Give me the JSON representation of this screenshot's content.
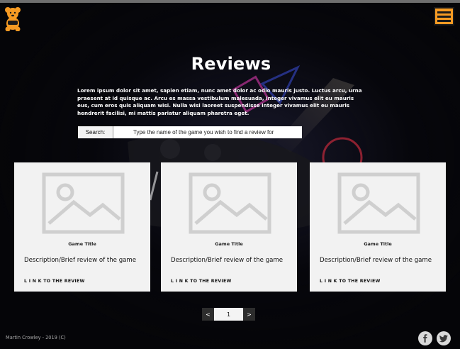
{
  "header": {
    "logo_icon": "teddy-bear-gamepad-logo-icon",
    "menu_icon": "hamburger-menu-icon",
    "accent_color": "#f59a23"
  },
  "main": {
    "title": "Reviews",
    "intro": "Lorem ipsum dolor sit amet, sapien etiam, nunc amet dolor ac odio mauris justo. Luctus arcu, urna praesent at id quisque ac. Arcu es massa vestibulum malesuada, integer vivamus elit eu mauris eus, cum eros quis aliquam wisi. Nulla wisi laoreet suspendisse integer vivamus elit eu mauris hendrerit facilisi, mi mattis pariatur aliquam pharetra eget.",
    "search": {
      "label": "Search:",
      "placeholder": "Type the name of the game you wish to find a review for"
    }
  },
  "cards": [
    {
      "image_icon": "image-placeholder-icon",
      "title": "Game Title",
      "description": "Description/Brief review of the game",
      "link": "L I N K TO THE REVIEW"
    },
    {
      "image_icon": "image-placeholder-icon",
      "title": "Game Title",
      "description": "Description/Brief review of the game",
      "link": "L I N K TO THE REVIEW"
    },
    {
      "image_icon": "image-placeholder-icon",
      "title": "Game Title",
      "description": "Description/Brief review of the game",
      "link": "L I N K TO THE REVIEW"
    }
  ],
  "pagination": {
    "prev": "<",
    "current": "1",
    "next": ">"
  },
  "footer": {
    "credit": "Martin Crowley - 2019 (C)",
    "social": [
      "facebook-icon",
      "twitter-icon"
    ]
  }
}
